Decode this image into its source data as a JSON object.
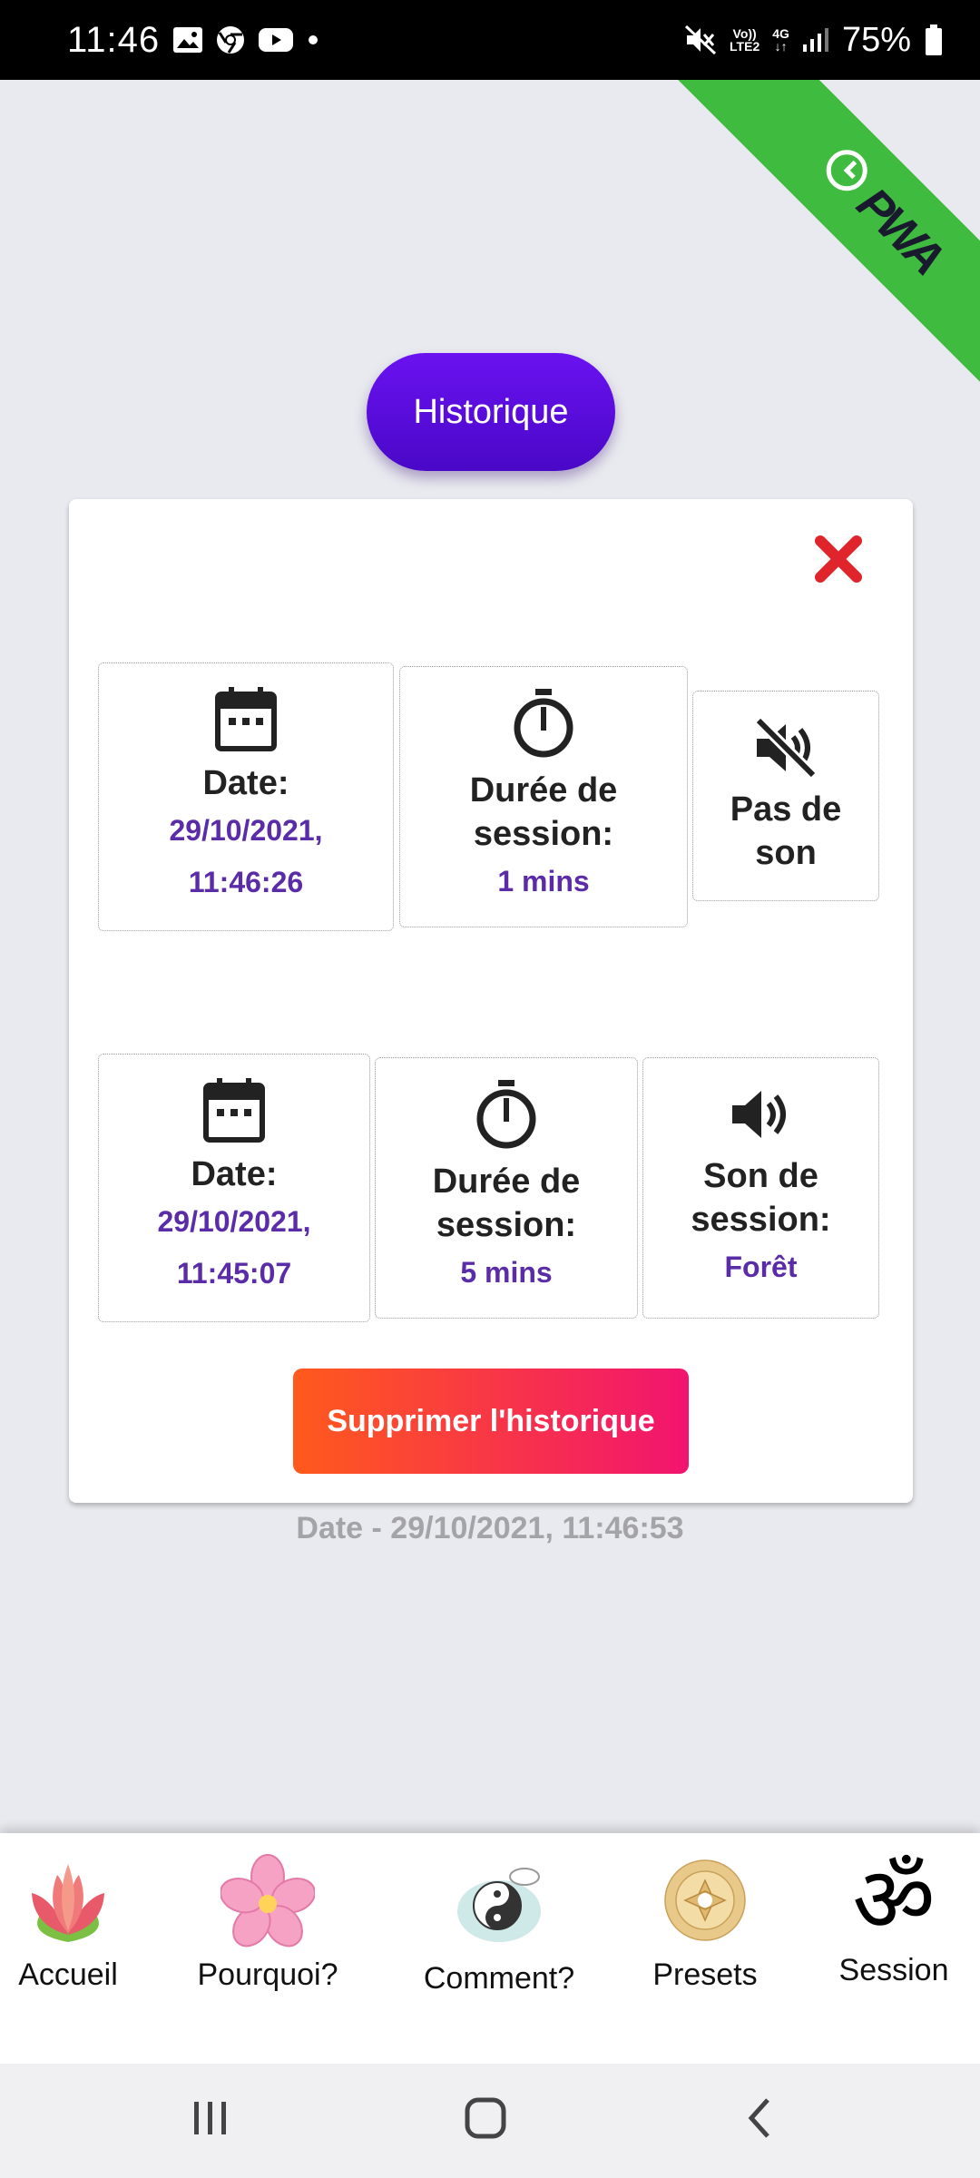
{
  "status_bar": {
    "time": "11:46",
    "network_top": "Vo))",
    "network_bottom": "LTE2",
    "signal_type": "4G",
    "battery": "75%"
  },
  "ribbon": {
    "label": "PWA"
  },
  "header": {
    "button_label": "Historique"
  },
  "history": [
    {
      "date_label": "Date:",
      "date_value": "29/10/2021,",
      "time_value": "11:46:26",
      "duration_label": "Durée de session:",
      "duration_value": "1 mins",
      "sound_label": "Pas de son",
      "sound_icon": "volume-off-icon"
    },
    {
      "date_label": "Date:",
      "date_value": "29/10/2021,",
      "time_value": "11:45:07",
      "duration_label": "Durée de session:",
      "duration_value": "5 mins",
      "sound_label": "Son de session:",
      "sound_value": "Forêt",
      "sound_icon": "volume-on-icon"
    }
  ],
  "delete_button": "Supprimer l'historique",
  "footer_date": "Date - 29/10/2021, 11:46:53",
  "nav": [
    {
      "label": "Accueil",
      "icon": "lotus-icon"
    },
    {
      "label": "Pourquoi?",
      "icon": "flower-icon"
    },
    {
      "label": "Comment?",
      "icon": "yin-yang-icon"
    },
    {
      "label": "Presets",
      "icon": "mandala-icon"
    },
    {
      "label": "Session",
      "icon": "om-icon"
    }
  ],
  "colors": {
    "accent_purple": "#5b2ca8",
    "button_purple": "#5a0edb",
    "delete_gradient_start": "#ff5a1c",
    "delete_gradient_end": "#f1146f",
    "ribbon_green": "#3fbb3f",
    "close_red": "#e0242c"
  }
}
